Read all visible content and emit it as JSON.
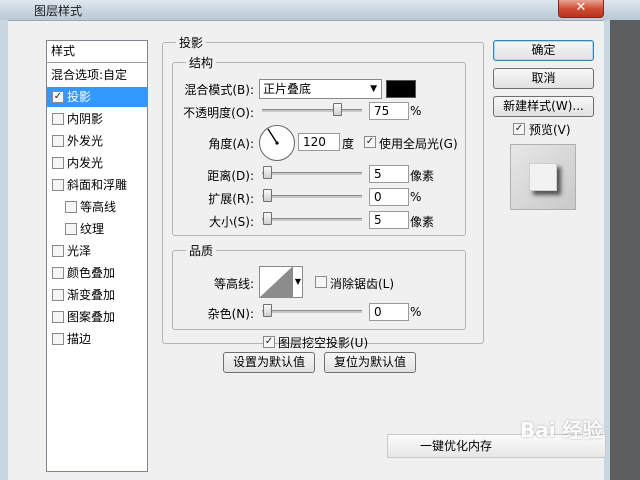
{
  "window": {
    "title": "图层样式",
    "close_label": "✕"
  },
  "stylelist": {
    "header": "样式",
    "items": [
      {
        "label": "混合选项:自定",
        "checkbox": false
      },
      {
        "label": "投影",
        "checkbox": true,
        "checked": true,
        "selected": true
      },
      {
        "label": "内阴影",
        "checkbox": true,
        "checked": false
      },
      {
        "label": "外发光",
        "checkbox": true,
        "checked": false
      },
      {
        "label": "内发光",
        "checkbox": true,
        "checked": false
      },
      {
        "label": "斜面和浮雕",
        "checkbox": true,
        "checked": false
      },
      {
        "label": "等高线",
        "checkbox": true,
        "checked": false,
        "indent": true
      },
      {
        "label": "纹理",
        "checkbox": true,
        "checked": false,
        "indent": true
      },
      {
        "label": "光泽",
        "checkbox": true,
        "checked": false
      },
      {
        "label": "颜色叠加",
        "checkbox": true,
        "checked": false
      },
      {
        "label": "渐变叠加",
        "checkbox": true,
        "checked": false
      },
      {
        "label": "图案叠加",
        "checkbox": true,
        "checked": false
      },
      {
        "label": "描边",
        "checkbox": true,
        "checked": false
      }
    ]
  },
  "drop_shadow": {
    "title": "投影",
    "structure": {
      "title": "结构",
      "blend_mode_label": "混合模式(B):",
      "blend_mode_value": "正片叠底",
      "color": "#000000",
      "opacity_label": "不透明度(O):",
      "opacity_value": "75",
      "opacity_unit": "%",
      "opacity_level": 0.75,
      "angle_label": "角度(A):",
      "angle_value": "120",
      "angle_unit": "度",
      "global_light_label": "使用全局光(G)",
      "global_light_checked": true,
      "distance_label": "距离(D):",
      "distance_value": "5",
      "distance_unit": "像素",
      "spread_label": "扩展(R):",
      "spread_value": "0",
      "spread_unit": "%",
      "size_label": "大小(S):",
      "size_value": "5",
      "size_unit": "像素"
    },
    "quality": {
      "title": "品质",
      "contour_label": "等高线:",
      "antialias_label": "消除锯齿(L)",
      "antialias_checked": false,
      "noise_label": "杂色(N):",
      "noise_value": "0",
      "noise_unit": "%"
    },
    "knockout_label": "图层挖空投影(U)",
    "knockout_checked": true,
    "make_default": "设置为默认值",
    "reset_default": "复位为默认值"
  },
  "buttons": {
    "ok": "确定",
    "cancel": "取消",
    "new_style": "新建样式(W)...",
    "preview_label": "预览(V)",
    "preview_checked": true
  },
  "overlay": {
    "optimize_memory": "一键优化内存",
    "watermark": "Bai 经验"
  },
  "colors": {
    "selection": "#3399ff",
    "close_button": "#cf4f37",
    "shadow_color": "#000000"
  }
}
